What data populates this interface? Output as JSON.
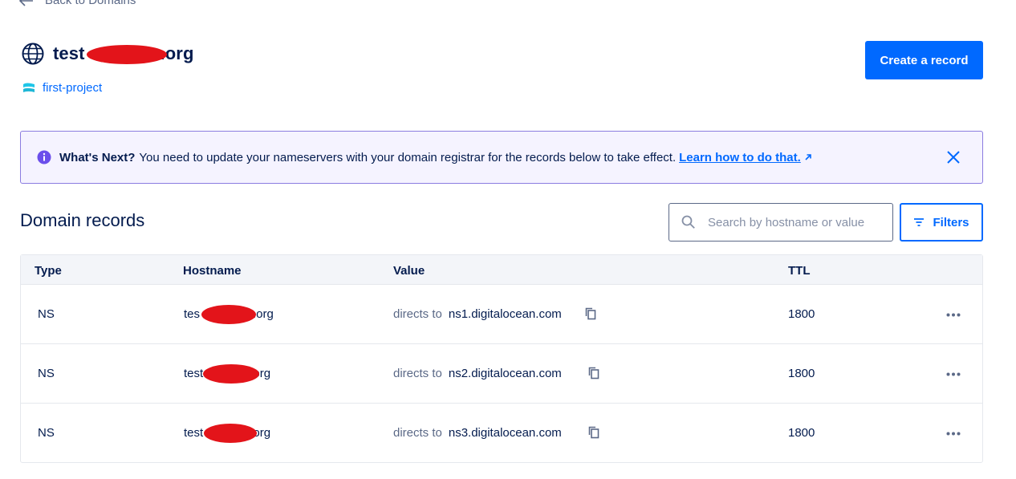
{
  "nav": {
    "back_label": "Back to Domains"
  },
  "domain": {
    "prefix": "test",
    "suffix": ".org",
    "project": "first-project"
  },
  "actions": {
    "create_record": "Create a record",
    "filters": "Filters"
  },
  "banner": {
    "title": "What's Next?",
    "message": "You need to update your nameservers with your domain registrar for the records below to take effect.",
    "link": "Learn how to do that."
  },
  "records": {
    "title": "Domain records",
    "search_placeholder": "Search by hostname or value",
    "columns": {
      "type": "Type",
      "hostname": "Hostname",
      "value": "Value",
      "ttl": "TTL"
    },
    "directs_label": "directs to",
    "rows": [
      {
        "type": "NS",
        "host_prefix": "tes",
        "host_suffix": ".org",
        "value": "ns1.digitalocean.com",
        "ttl": "1800"
      },
      {
        "type": "NS",
        "host_prefix": "test",
        "host_suffix": ".org",
        "value": "ns2.digitalocean.com",
        "ttl": "1800"
      },
      {
        "type": "NS",
        "host_prefix": "test",
        "host_suffix": ".org",
        "value": "ns3.digitalocean.com",
        "ttl": "1800"
      }
    ]
  },
  "colors": {
    "brand_blue": "#0069ff",
    "navy_text": "#031b4e",
    "banner_border": "#8b7ce0",
    "redaction": "#e3141a"
  },
  "icons": [
    "arrow-left-icon",
    "globe-icon",
    "project-icon",
    "info-icon",
    "external-link-icon",
    "close-icon",
    "search-icon",
    "filter-icon",
    "copy-icon",
    "more-icon"
  ]
}
